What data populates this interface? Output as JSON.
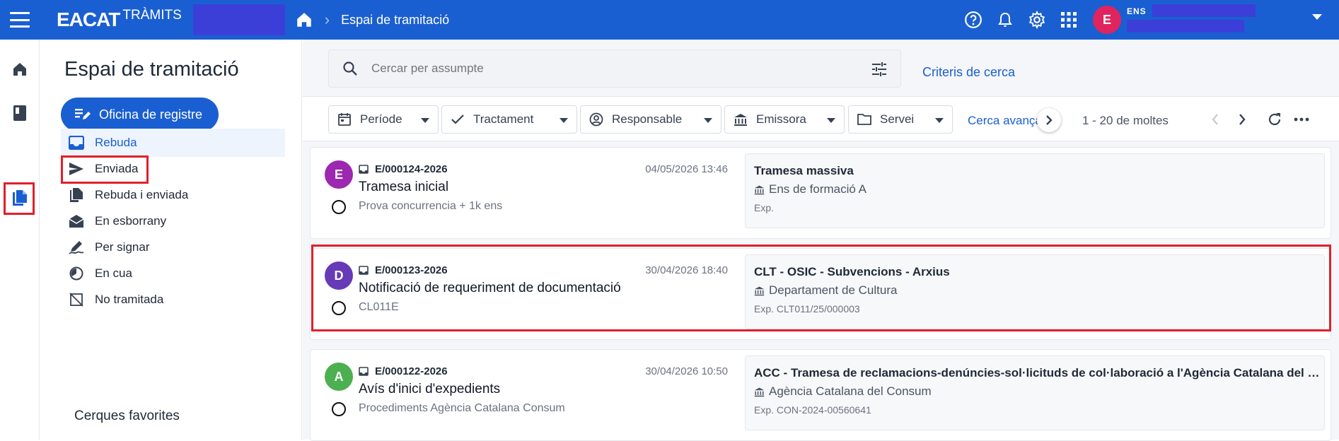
{
  "topbar": {
    "logo": "EACAT",
    "logo_sub": "TRÀMITS",
    "breadcrumb": "Espai de tramitació",
    "user_label": "ENS",
    "user_initial": "E",
    "colors": {
      "bar": "#1a5fd1",
      "avatar": "#e0245e"
    }
  },
  "nav": {
    "title": "Espai de tramitació",
    "office_button": "Oficina de registre",
    "items": [
      {
        "label": "Rebuda",
        "icon": "inbox-icon",
        "active": true
      },
      {
        "label": "Enviada",
        "icon": "send-icon"
      },
      {
        "label": "Rebuda i enviada",
        "icon": "copy-icon"
      },
      {
        "label": "En esborrany",
        "icon": "draft-mail-icon"
      },
      {
        "label": "Per signar",
        "icon": "signature-icon"
      },
      {
        "label": "En cua",
        "icon": "clock-icon"
      },
      {
        "label": "No tramitada",
        "icon": "no-doc-icon"
      }
    ],
    "favorites_title": "Cerques favorites"
  },
  "search": {
    "placeholder": "Cercar per assumpte",
    "criteria_link": "Criteris de cerca"
  },
  "filters": {
    "chips": [
      "Període",
      "Tractament",
      "Responsable",
      "Emissora",
      "Servei"
    ],
    "advanced": "Cerca avançada",
    "pagination": "1 - 20 de moltes"
  },
  "cards": [
    {
      "initial": "E",
      "color": "#9c27b0",
      "code": "E/000124-2026",
      "date": "04/05/2026 13:46",
      "title": "Tramesa inicial",
      "subtitle": "Prova concurrencia + 1k ens",
      "info_title": "Tramesa massiva",
      "info_org": "Ens de formació A",
      "info_exp": "Exp."
    },
    {
      "initial": "D",
      "color": "#673ab7",
      "code": "E/000123-2026",
      "date": "30/04/2026 18:40",
      "title": "Notificació de requeriment de documentació",
      "subtitle": "CL011E",
      "info_title": "CLT - OSIC - Subvencions - Arxius",
      "info_org": "Departament de Cultura",
      "info_exp": "Exp. CLT011/25/000003"
    },
    {
      "initial": "A",
      "color": "#4caf50",
      "code": "E/000122-2026",
      "date": "30/04/2026 10:50",
      "title": "Avís d'inici d'expedients",
      "subtitle": "Procediments Agència Catalana Consum",
      "info_title": "ACC - Tramesa de reclamacions-denúncies-sol·licituds de col·laboració a l'Agència Catalana del Consum",
      "info_org": "Agència Catalana del Consum",
      "info_exp": "Exp. CON-2024-00560641"
    }
  ]
}
